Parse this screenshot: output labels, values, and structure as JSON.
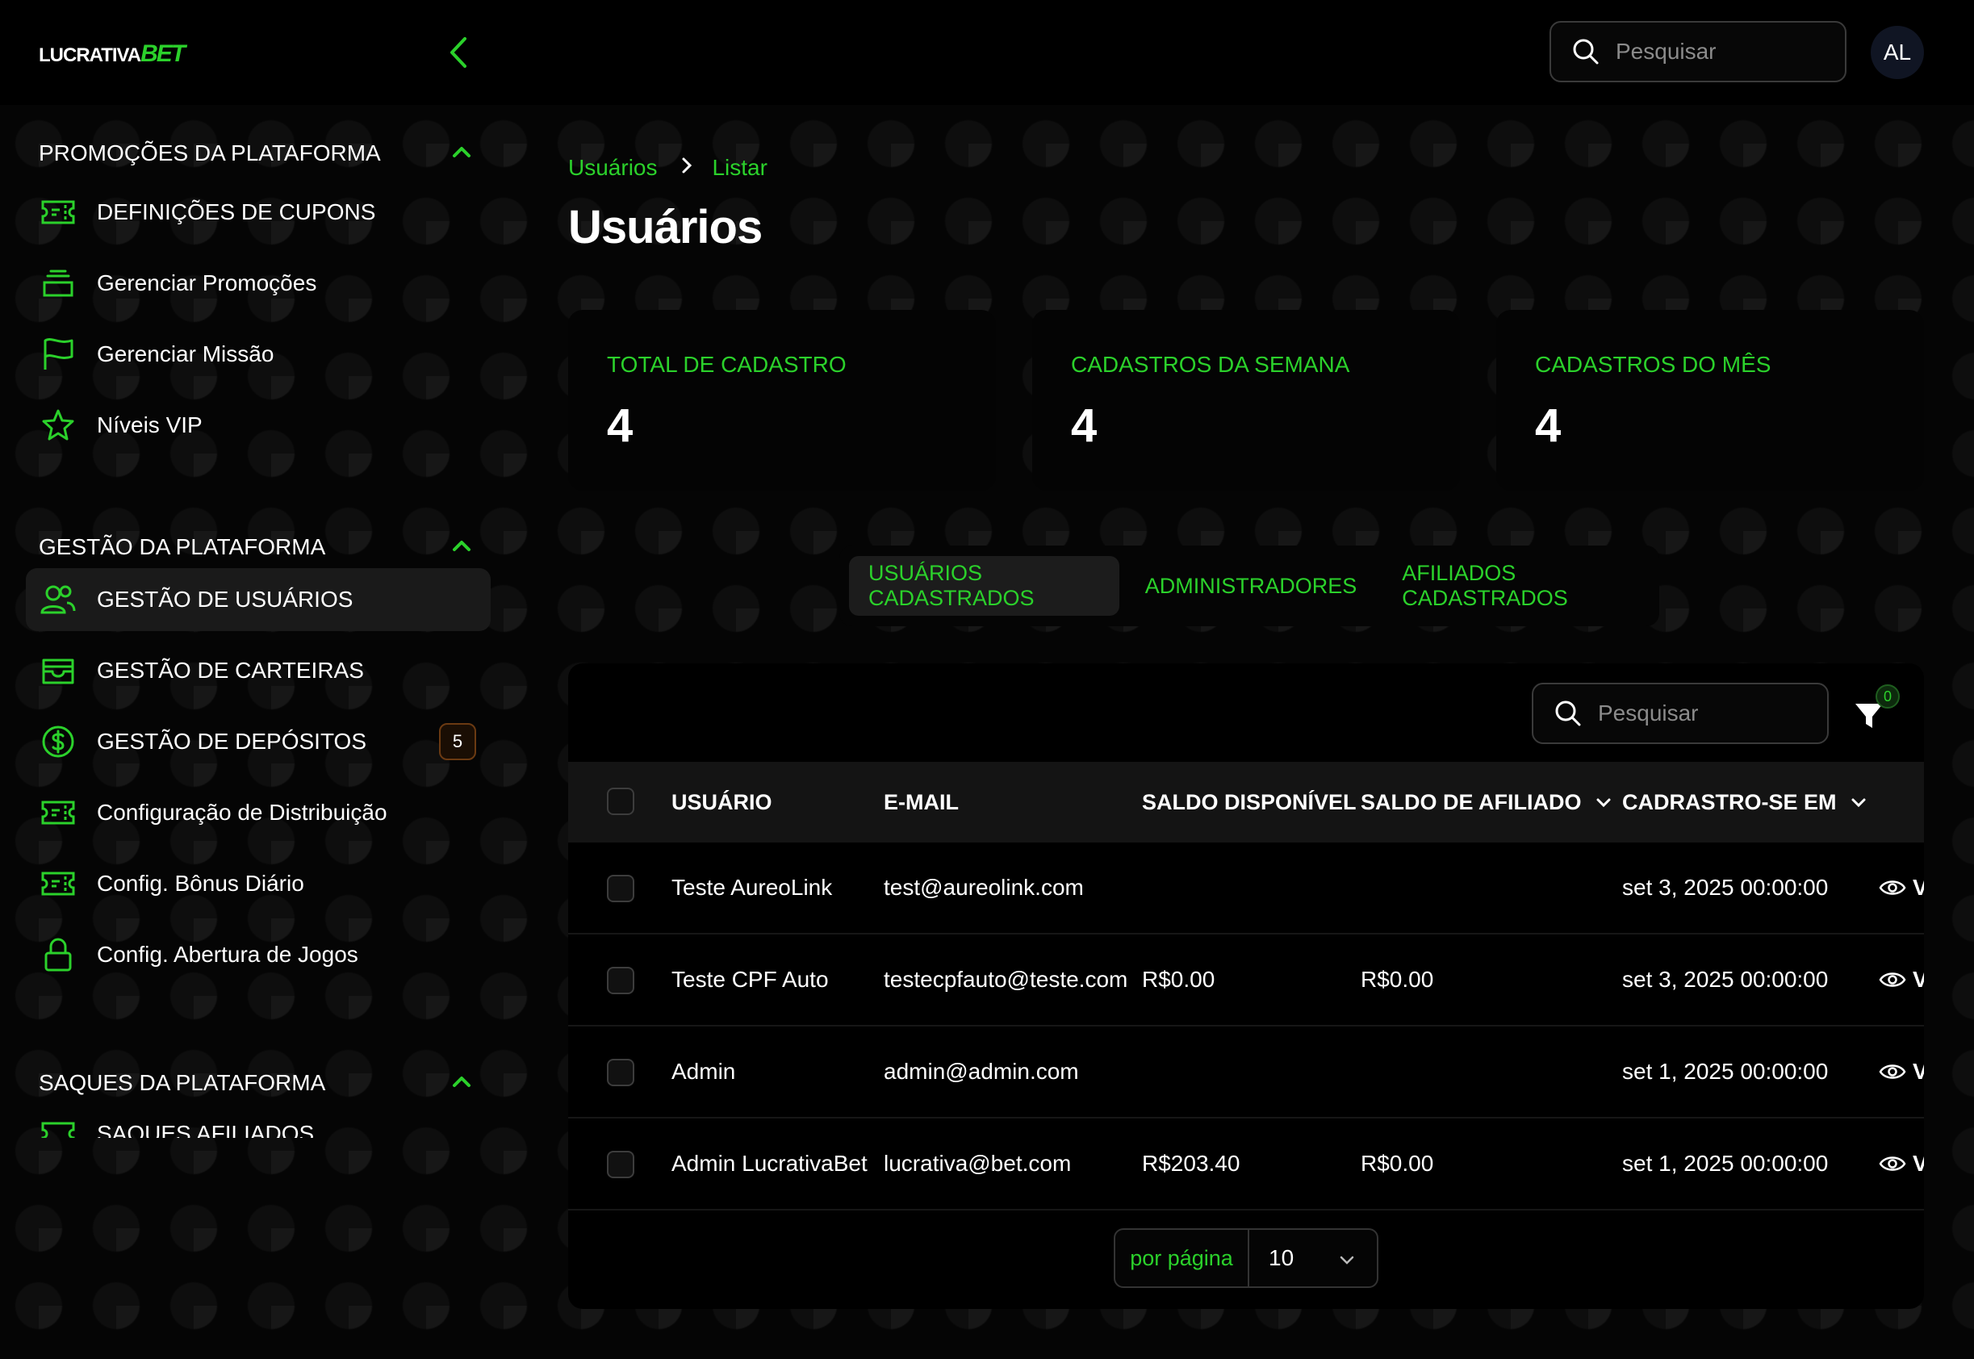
{
  "brand": {
    "part1": "LUCRATIVA",
    "part2": "BET"
  },
  "header": {
    "search_placeholder": "Pesquisar",
    "avatar_initials": "AL"
  },
  "sidebar": {
    "sections": [
      {
        "title": "PROMOÇÕES DA PLATAFORMA"
      },
      {
        "title": "GESTÃO DA PLATAFORMA"
      },
      {
        "title": "SAQUES DA PLATAFORMA"
      }
    ],
    "items": [
      {
        "label": "DEFINIÇÕES DE CUPONS",
        "icon": "ticket-icon"
      },
      {
        "label": "Gerenciar Promoções",
        "icon": "inbox-stack-icon"
      },
      {
        "label": "Gerenciar Missão",
        "icon": "flag-icon"
      },
      {
        "label": "Níveis VIP",
        "icon": "star-icon"
      },
      {
        "label": "GESTÃO DE USUÁRIOS",
        "icon": "users-icon"
      },
      {
        "label": "GESTÃO DE CARTEIRAS",
        "icon": "wallet-icon"
      },
      {
        "label": "GESTÃO DE DEPÓSITOS",
        "icon": "dollar-circle-icon",
        "badge": "5"
      },
      {
        "label": "Configuração de Distribuição",
        "icon": "ticket-icon"
      },
      {
        "label": "Config. Bônus Diário",
        "icon": "ticket-icon"
      },
      {
        "label": "Config. Abertura de Jogos",
        "icon": "lock-icon"
      },
      {
        "label": "SAQUES AFILIADOS",
        "icon": "ticket-icon"
      }
    ]
  },
  "breadcrumb": {
    "root": "Usuários",
    "current": "Listar"
  },
  "page_title": "Usuários",
  "stats": [
    {
      "label": "TOTAL DE CADASTRO",
      "value": "4"
    },
    {
      "label": "CADASTROS DA SEMANA",
      "value": "4"
    },
    {
      "label": "CADASTROS DO MÊS",
      "value": "4"
    }
  ],
  "tabs": [
    {
      "label": "USUÁRIOS CADASTRADOS",
      "active": true
    },
    {
      "label": "ADMINISTRADORES"
    },
    {
      "label": "AFILIADOS CADASTRADOS"
    }
  ],
  "table": {
    "search_placeholder": "Pesquisar",
    "filter_count": "0",
    "columns": [
      "USUÁRIO",
      "E-MAIL",
      "SALDO DISPONÍVEL",
      "SALDO DE AFILIADO",
      "CADRASTRO-SE EM"
    ],
    "rows": [
      {
        "user": "Teste AureoLink",
        "email": "test@aureolink.com",
        "balance": "",
        "affiliate": "",
        "created": "set 3, 2025 00:00:00",
        "action": "V"
      },
      {
        "user": "Teste CPF Auto",
        "email": "testecpfauto@teste.com",
        "balance": "R$0.00",
        "affiliate": "R$0.00",
        "created": "set 3, 2025 00:00:00",
        "action": "V"
      },
      {
        "user": "Admin",
        "email": "admin@admin.com",
        "balance": "",
        "affiliate": "",
        "created": "set 1, 2025 00:00:00",
        "action": "V"
      },
      {
        "user": "Admin LucrativaBet",
        "email": "lucrativa@bet.com",
        "balance": "R$203.40",
        "affiliate": "R$0.00",
        "created": "set 1, 2025 00:00:00",
        "action": "V"
      }
    ]
  },
  "pagination": {
    "label": "por página",
    "value": "10"
  },
  "colors": {
    "accent": "#2bd12b",
    "background": "#000000",
    "badge_border": "#6b3a12"
  }
}
